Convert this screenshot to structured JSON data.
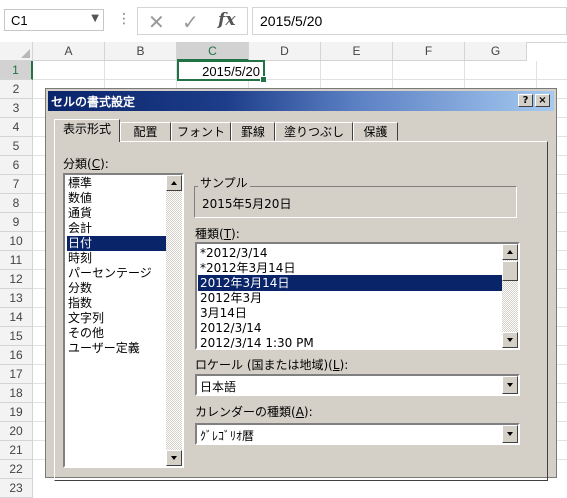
{
  "formula_bar": {
    "name_box": "C1",
    "separator": "⋮",
    "cancel_glyph": "✕",
    "enter_glyph": "✓",
    "fx_label": "fx",
    "content": "2015/5/20"
  },
  "grid": {
    "columns": [
      "A",
      "B",
      "C",
      "D",
      "E",
      "F",
      "G"
    ],
    "selected_column": "C",
    "rows": [
      "1",
      "2",
      "3",
      "4",
      "5",
      "6",
      "7",
      "8",
      "9",
      "10",
      "11",
      "12",
      "13",
      "14",
      "15",
      "16",
      "17",
      "18",
      "19",
      "20",
      "21",
      "22",
      "23"
    ],
    "selected_row": "1",
    "active_cell_value": "2015/5/20"
  },
  "dialog": {
    "title": "セルの書式設定",
    "help_label": "?",
    "close_label": "×",
    "tabs": [
      {
        "label": "表示形式",
        "active": true
      },
      {
        "label": "配置"
      },
      {
        "label": "フォント"
      },
      {
        "label": "罫線"
      },
      {
        "label": "塗りつぶし"
      },
      {
        "label": "保護"
      }
    ],
    "category": {
      "label_prefix": "分類(",
      "label_key": "C",
      "label_suffix": "):",
      "items": [
        "標準",
        "数値",
        "通貨",
        "会計",
        "日付",
        "時刻",
        "パーセンテージ",
        "分数",
        "指数",
        "文字列",
        "その他",
        "ユーザー定義"
      ],
      "selected_index": 4
    },
    "sample": {
      "legend": "サンプル",
      "value": "2015年5月20日"
    },
    "type": {
      "label_prefix": "種類(",
      "label_key": "T",
      "label_suffix": "):",
      "items": [
        "*2012/3/14",
        "*2012年3月14日",
        "2012年3月14日",
        "2012年3月",
        "3月14日",
        "2012/3/14",
        "2012/3/14 1:30 PM"
      ],
      "selected_index": 2
    },
    "locale": {
      "label_prefix": "ロケール (国または地域)(",
      "label_key": "L",
      "label_suffix": "):",
      "value": "日本語"
    },
    "calendar": {
      "label_prefix": "カレンダーの種類(",
      "label_key": "A",
      "label_suffix": "):",
      "value": "ｸﾞﾚｺﾞﾘｵ暦"
    }
  }
}
